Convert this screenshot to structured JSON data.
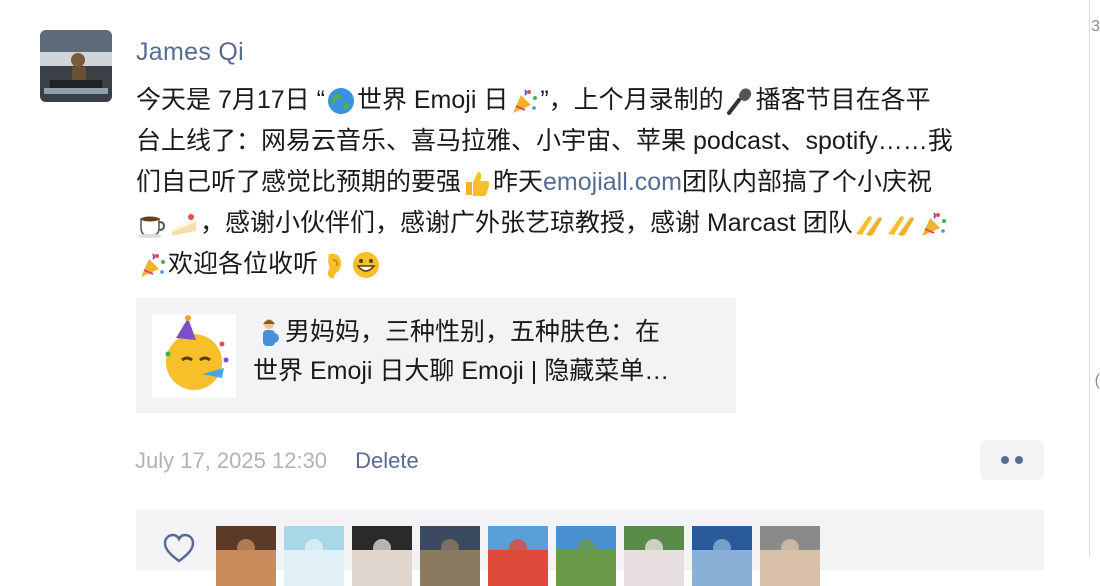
{
  "post": {
    "author": "James Qi",
    "text_lines": [
      [
        "今天是 7月17日 “",
        "{globe-emoji}",
        "世界 Emoji 日",
        "{party-popper-emoji}",
        "”，上个月录制的",
        "{microphone-emoji}",
        "播客节目在各平"
      ],
      [
        "台上线了：网易云音乐、喜马拉雅、小宇宙、苹果 podcast、spotify……我"
      ],
      [
        "们自己听了感觉比预期的要强",
        "{thumbs-up-emoji}",
        "昨天 ",
        "{link}",
        " 团队内部搞了个小庆祝"
      ],
      [
        "{coffee-emoji}",
        "{cake-emoji}",
        "，感谢小伙伴们，感谢广外张艺琼教授，感谢 Marcast 团队",
        "{pray-emoji}",
        "{pray-emoji}",
        "{party-popper-emoji}"
      ],
      [
        "{party-popper-emoji}",
        "欢迎各位收听",
        "{ear-emoji}",
        "{grin-emoji}"
      ]
    ],
    "link_text": "emojiall.com",
    "link_card": {
      "thumb_icon": "partying-face-emoji",
      "title_line1_emoji": "pregnant-man-emoji",
      "title_line1": "男妈妈，三种性别，五种肤色：在",
      "title_line2": "世界 Emoji 日大聊 Emoji | 隐藏菜单…"
    },
    "timestamp": "July 17, 2025 12:30",
    "delete_label": "Delete",
    "more_icon": "more-dots-icon",
    "like_icon": "heart-outline-icon"
  },
  "likers": [
    "liker-1",
    "liker-2",
    "liker-3",
    "liker-4",
    "liker-5",
    "liker-6",
    "liker-7",
    "liker-8",
    "liker-9"
  ],
  "colors": {
    "link": "#576b95",
    "meta": "#b2b2b2",
    "card_bg": "#f3f3f5"
  }
}
